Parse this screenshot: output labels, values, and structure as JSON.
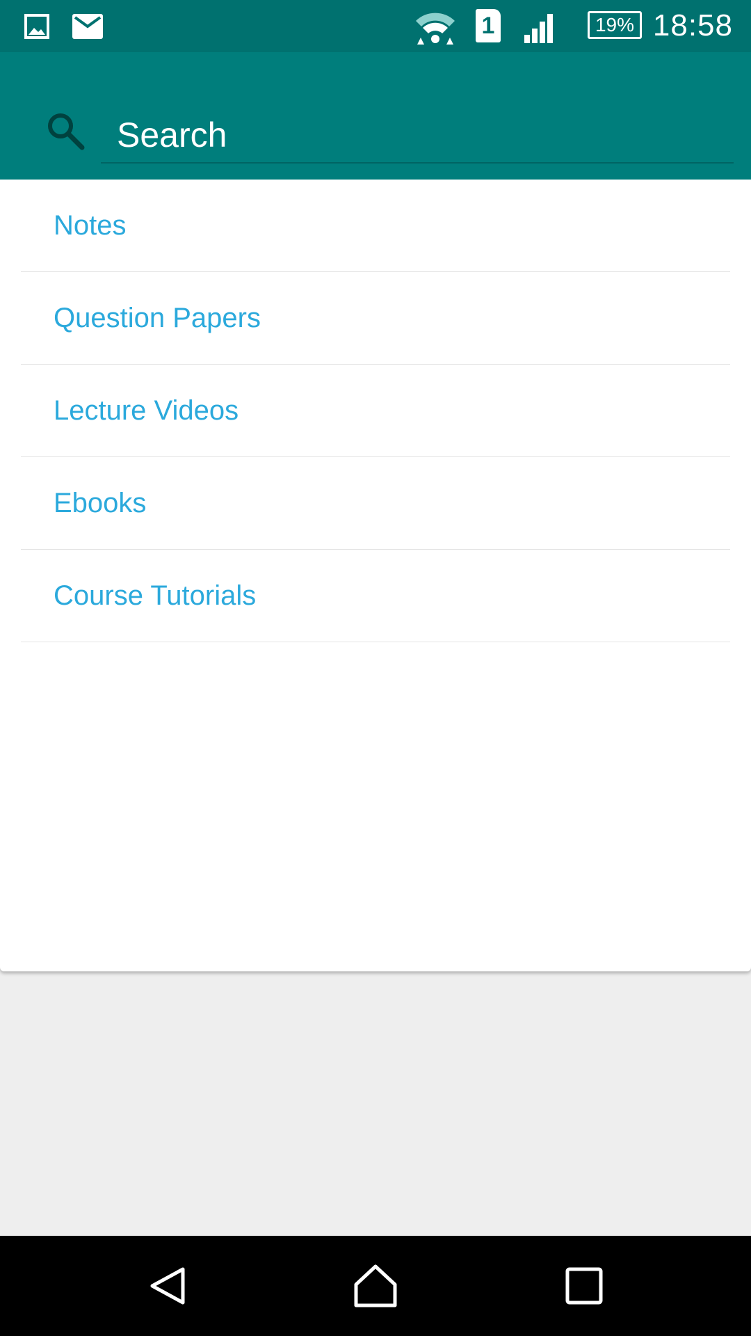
{
  "status_bar": {
    "icons": [
      "image-notification-icon",
      "mail-notification-icon",
      "wifi-icon",
      "sim-1-icon",
      "signal-icon",
      "battery-icon"
    ],
    "sim_slot": "1",
    "battery_percent": "19%",
    "time": "18:58"
  },
  "search": {
    "placeholder": "Search",
    "value": ""
  },
  "categories": [
    {
      "label": "Notes"
    },
    {
      "label": "Question Papers"
    },
    {
      "label": "Lecture Videos"
    },
    {
      "label": "Ebooks"
    },
    {
      "label": "Course Tutorials"
    }
  ],
  "nav_bar": {
    "buttons": [
      "back-icon",
      "home-icon",
      "recents-icon"
    ]
  },
  "colors": {
    "status_bar": "#00716f",
    "app_bar": "#007e7c",
    "list_text": "#2ba9dc",
    "background": "#eeeeee",
    "nav_bar": "#000000"
  }
}
